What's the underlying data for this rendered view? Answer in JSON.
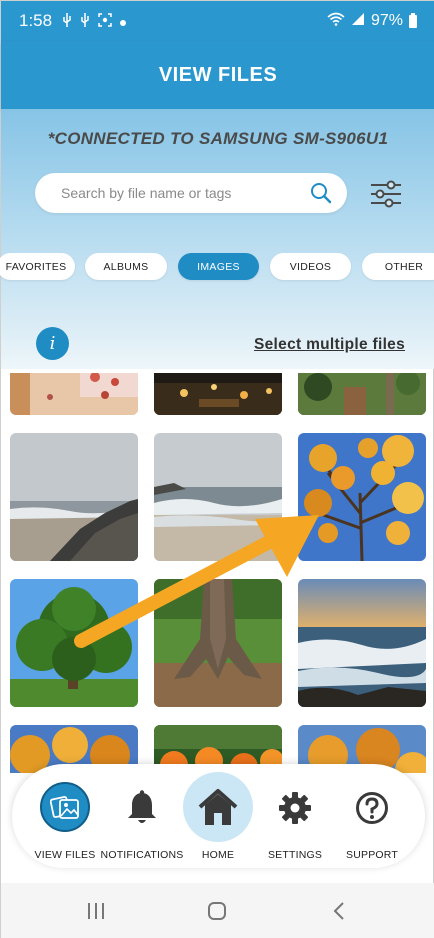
{
  "status_bar": {
    "time": "1:58",
    "battery": "97%",
    "icons": [
      "usb-icon",
      "usb-icon",
      "screenshot-icon",
      "dot-icon",
      "wifi-icon",
      "signal-icon",
      "battery-icon"
    ]
  },
  "header": {
    "title": "VIEW FILES"
  },
  "connection": {
    "text": "*CONNECTED TO SAMSUNG SM-S906U1"
  },
  "search": {
    "placeholder": "Search by file name or tags"
  },
  "categories": [
    {
      "label": "FAVORITES",
      "active": false
    },
    {
      "label": "ALBUMS",
      "active": false
    },
    {
      "label": "IMAGES",
      "active": true
    },
    {
      "label": "VIDEOS",
      "active": false
    },
    {
      "label": "OTHER",
      "active": false
    }
  ],
  "toolbar": {
    "info": "i",
    "select_multiple": "Select multiple files"
  },
  "thumbnails": [
    "photo-quilt",
    "photo-night-lights",
    "photo-garden",
    "photo-foggy-beach-rocks",
    "photo-foggy-beach-waves",
    "photo-autumn-tree-sky",
    "photo-green-tree",
    "photo-tree-roots",
    "photo-sunset-waves",
    "photo-autumn-leaves",
    "photo-orange-flowers",
    "photo-autumn-foliage"
  ],
  "bottom_nav": [
    {
      "label": "VIEW FILES",
      "icon": "view-files-icon"
    },
    {
      "label": "NOTIFICATIONS",
      "icon": "bell-icon"
    },
    {
      "label": "HOME",
      "icon": "home-icon"
    },
    {
      "label": "SETTINGS",
      "icon": "gear-icon"
    },
    {
      "label": "SUPPORT",
      "icon": "help-icon"
    }
  ],
  "colors": {
    "primary": "#2b97cf",
    "active_chip": "#1f8cc4",
    "arrow": "#f5a623"
  }
}
